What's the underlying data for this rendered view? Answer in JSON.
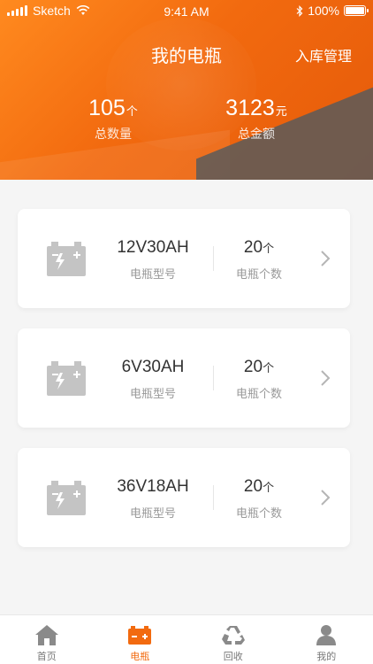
{
  "status_bar": {
    "carrier": "Sketch",
    "time": "9:41 AM",
    "battery": "100%"
  },
  "header": {
    "title": "我的电瓶",
    "manage_label": "入库管理",
    "total_count": {
      "value": "105",
      "unit": "个",
      "label": "总数量"
    },
    "total_amount": {
      "value": "3123",
      "unit": "元",
      "label": "总金额"
    }
  },
  "batteries": [
    {
      "model": "12V30AH",
      "model_label": "电瓶型号",
      "count": "20",
      "count_unit": "个",
      "count_label": "电瓶个数"
    },
    {
      "model": "6V30AH",
      "model_label": "电瓶型号",
      "count": "20",
      "count_unit": "个",
      "count_label": "电瓶个数"
    },
    {
      "model": "36V18AH",
      "model_label": "电瓶型号",
      "count": "20",
      "count_unit": "个",
      "count_label": "电瓶个数"
    }
  ],
  "tabbar": {
    "tabs": [
      {
        "label": "首页",
        "icon": "home-icon",
        "active": false
      },
      {
        "label": "电瓶",
        "icon": "battery-icon",
        "active": true
      },
      {
        "label": "回收",
        "icon": "recycle-icon",
        "active": false
      },
      {
        "label": "我的",
        "icon": "user-icon",
        "active": false
      }
    ]
  },
  "colors": {
    "accent": "#f26a0f",
    "icon_gray": "#c4c4c4",
    "tab_gray": "#8a8a8a"
  }
}
